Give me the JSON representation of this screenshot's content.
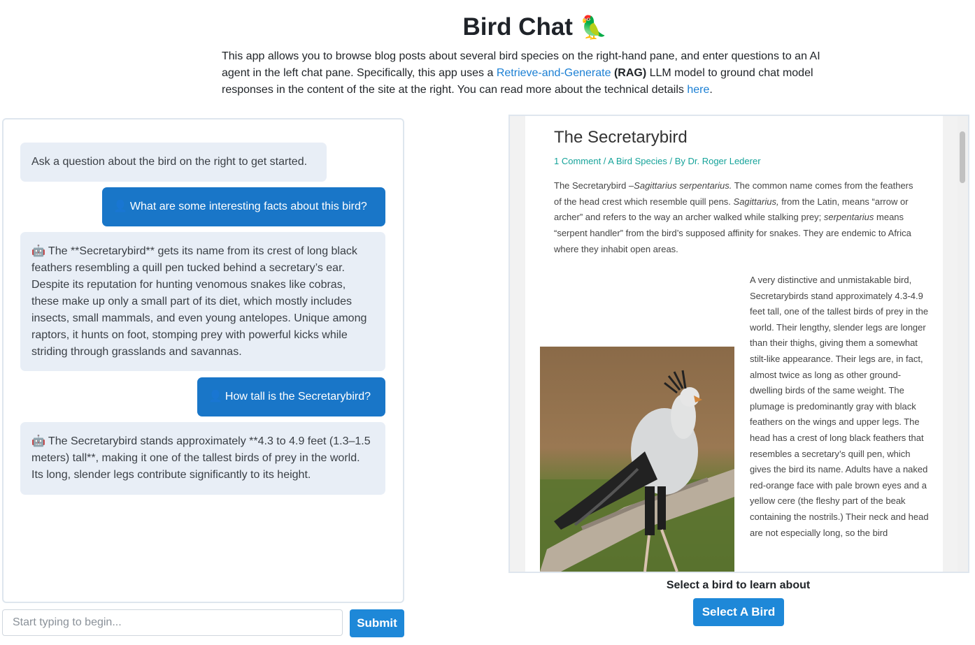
{
  "header": {
    "title": "Bird Chat",
    "title_icon": "🦜",
    "intro_part1": "This app allows you to browse blog posts about several bird species on the right-hand pane, and enter questions to an AI agent in the left chat pane. Specifically, this app uses a ",
    "rag_link": "Retrieve-and-Generate",
    "rag_abbr": "(RAG)",
    "intro_part2": " LLM model to ground chat model responses in the content of the site at the right. You can read more about the technical details ",
    "here_link": "here",
    "intro_end": "."
  },
  "chat": {
    "messages": [
      {
        "role": "bot",
        "icon": "",
        "text": "Ask a question about the bird on the right to get started."
      },
      {
        "role": "user",
        "icon": "👤",
        "text": "What are some interesting facts about this bird?"
      },
      {
        "role": "bot",
        "icon": "🤖",
        "text": "The **Secretarybird** gets its name from its crest of long black feathers resembling a quill pen tucked behind a secretary’s ear. Despite its reputation for hunting venomous snakes like cobras, these make up only a small part of its diet, which mostly includes insects, small mammals, and even young antelopes. Unique among raptors, it hunts on foot, stomping prey with powerful kicks while striding through grasslands and savannas."
      },
      {
        "role": "user",
        "icon": "👤",
        "text": "How tall is the Secretarybird?"
      },
      {
        "role": "bot",
        "icon": "🤖",
        "text": "The Secretarybird stands approximately **4.3 to 4.9 feet (1.3–1.5 meters) tall**, making it one of the tallest birds of prey in the world. Its long, slender legs contribute significantly to its height."
      }
    ],
    "input_placeholder": "Start typing to begin...",
    "submit_label": "Submit"
  },
  "article": {
    "title": "The Secretarybird",
    "meta": "1 Comment / A Bird Species / By Dr. Roger Lederer",
    "intro_a": "The Secretarybird –",
    "intro_sci": "Sagittarius serpentarius.",
    "intro_b": " The common name comes from the feathers of the head crest which resemble  quill pens. ",
    "intro_sag": "Sagittarius,",
    "intro_c": " from the Latin, means “arrow or archer” and refers to the way an archer walked while stalking prey; ",
    "intro_serp": "serpentarius",
    "intro_d": " means “serpent handler” from the bird’s supposed affinity for snakes. They are endemic to Africa where they inhabit open areas.",
    "body": "A very distinctive and unmistakable bird, Secretarybirds stand approximately 4.3-4.9 feet tall, one of the tallest birds of prey in the world. Their lengthy, slender legs are longer than their thighs, giving them a somewhat stilt-like appearance. Their legs are, in fact, almost twice as long as other ground-dwelling birds of the same weight. The plumage is predominantly gray with black feathers on the wings and upper legs. The head has a crest of long black feathers that resembles a secretary’s quill pen, which gives the bird its name. Adults have a naked red-orange face with pale brown eyes and a yellow cere (the fleshy part of the beak containing the nostrils.) Their neck and head are not especially long, so the bird"
  },
  "selector": {
    "label": "Select a bird to learn about",
    "button_label": "Select A Bird"
  },
  "colors": {
    "accent": "#1e88d8",
    "user_bubble": "#1976c8",
    "bot_bubble": "#e8eef6",
    "link": "#1a7fd4",
    "meta_teal": "#16a39a"
  }
}
